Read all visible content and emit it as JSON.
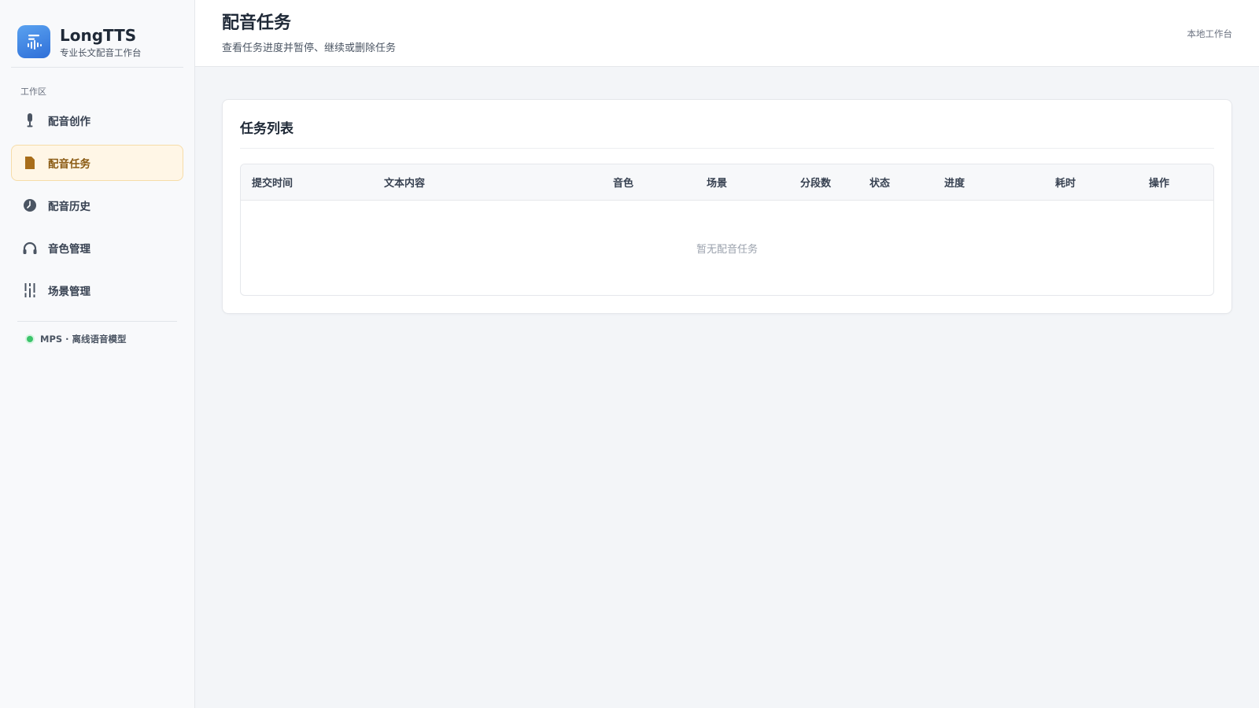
{
  "brand": {
    "title": "LongTTS",
    "subtitle": "专业长文配音工作台",
    "logo_icon": "waveform-icon",
    "accent": "#2f6fd8"
  },
  "sidebar": {
    "section_label": "工作区",
    "items": [
      {
        "label": "配音创作",
        "icon": "microphone-icon",
        "active": false
      },
      {
        "label": "配音任务",
        "icon": "document-icon",
        "active": true
      },
      {
        "label": "配音历史",
        "icon": "clock-icon",
        "active": false
      },
      {
        "label": "音色管理",
        "icon": "headphones-icon",
        "active": false
      },
      {
        "label": "场景管理",
        "icon": "sliders-icon",
        "active": false
      }
    ],
    "model_status": {
      "label": "MPS · 离线语音模型",
      "color": "#3cc46b"
    }
  },
  "header": {
    "title": "配音任务",
    "subtitle": "查看任务进度并暂停、继续或删除任务",
    "right_label": "本地工作台"
  },
  "task_card": {
    "title": "任务列表",
    "columns": [
      "提交时间",
      "文本内容",
      "音色",
      "场景",
      "分段数",
      "状态",
      "进度",
      "耗时",
      "操作"
    ],
    "empty_text": "暂无配音任务"
  },
  "colors": {
    "active_bg": "#fff6e6",
    "active_text": "#8a5a12"
  }
}
